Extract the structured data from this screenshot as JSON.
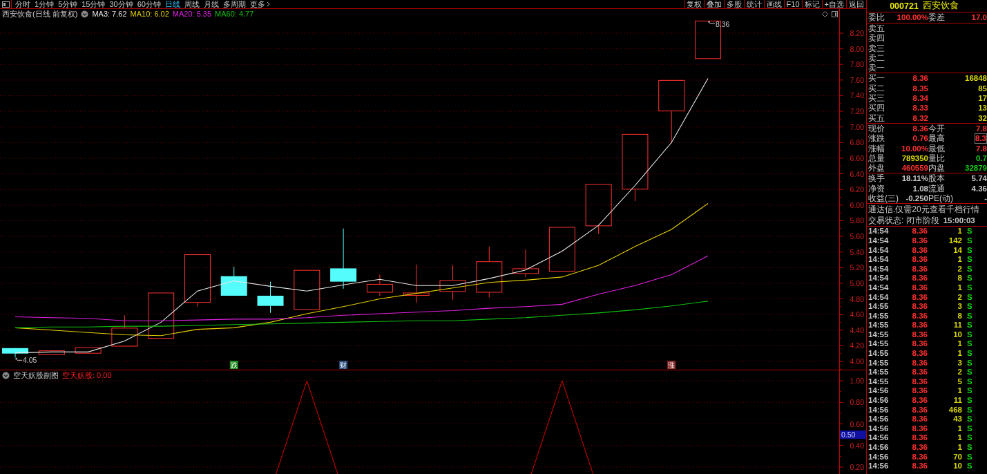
{
  "toolbar": {
    "periods": [
      {
        "label": "分时",
        "kind": "tab",
        "selected": false
      },
      {
        "label": "1分钟",
        "kind": "tab",
        "selected": false
      },
      {
        "label": "5分钟",
        "kind": "tab",
        "selected": false
      },
      {
        "label": "15分钟",
        "kind": "tab",
        "selected": false
      },
      {
        "label": "30分钟",
        "kind": "tab",
        "selected": false
      },
      {
        "label": "60分钟",
        "kind": "tab",
        "selected": false
      },
      {
        "label": "日线",
        "kind": "tab",
        "selected": true
      },
      {
        "label": "周线",
        "kind": "tab",
        "selected": false
      },
      {
        "label": "月线",
        "kind": "tab",
        "selected": false
      },
      {
        "label": "多周期",
        "kind": "tab",
        "selected": false
      },
      {
        "label": "更多",
        "kind": "menu",
        "selected": false
      }
    ],
    "actions": [
      "复权",
      "叠加",
      "多股",
      "统计",
      "画线",
      "F10",
      "标记",
      "+自选",
      "返回"
    ]
  },
  "main_chart": {
    "title": "西安饮食(日线 前复权)",
    "legend": [
      {
        "text": "MA3: 7.62",
        "color": "#e8e8e8"
      },
      {
        "text": "MA10: 6.02",
        "color": "#e6d000"
      },
      {
        "text": "MA20: 5.35",
        "color": "#e020e0"
      },
      {
        "text": "MA60: 4.77",
        "color": "#10c010"
      }
    ],
    "price_axis": [
      "8.20",
      "8.00",
      "7.80",
      "7.60",
      "7.40",
      "7.20",
      "7.00",
      "6.80",
      "6.60",
      "6.40",
      "6.20",
      "6.00",
      "5.80",
      "5.60",
      "5.40",
      "5.20",
      "5.00",
      "4.80",
      "4.60",
      "4.40",
      "4.20",
      "4.00"
    ],
    "high_label": "8.36",
    "low_label": "4.05",
    "events": [
      {
        "label": "跌",
        "color": "#1f8a1f"
      },
      {
        "label": "财",
        "color": "#2b4f80"
      },
      {
        "label": "涨",
        "color": "#8a2a2a"
      }
    ]
  },
  "sub_chart": {
    "title": "空天妖股副图",
    "legend": [
      {
        "text": "空天妖股: 0.00"
      }
    ],
    "axis": [
      "1.00",
      "0.80",
      "0.60",
      "0.40",
      "0.20"
    ],
    "cursor_value": "0.50"
  },
  "quote": {
    "code": "000721",
    "name": "西安饮食",
    "ratio": {
      "label": "委比",
      "value": "100.00%",
      "label2": "委差",
      "value2": "17.0"
    },
    "asks": [
      "卖五",
      "卖四",
      "卖三",
      "卖二",
      "卖一"
    ],
    "bids": [
      {
        "label": "买一",
        "price": "8.36",
        "volume": "16848"
      },
      {
        "label": "买二",
        "price": "8.35",
        "volume": "85"
      },
      {
        "label": "买三",
        "price": "8.34",
        "volume": "17"
      },
      {
        "label": "买四",
        "price": "8.33",
        "volume": "13"
      },
      {
        "label": "买五",
        "price": "8.32",
        "volume": "32"
      }
    ],
    "stats": [
      {
        "left": {
          "label": "现价",
          "value": "8.36",
          "color": "#ff3030"
        },
        "right": {
          "label": "今开",
          "value": "7.8",
          "color": "#ff3030",
          "highlighted": false
        }
      },
      {
        "left": {
          "label": "涨跌",
          "value": "0.76",
          "color": "#ff3030"
        },
        "right": {
          "label": "最高",
          "value": "8.3",
          "color": "#ff3030",
          "highlighted": true
        }
      },
      {
        "left": {
          "label": "涨幅",
          "value": "10.00%",
          "color": "#ff3030"
        },
        "right": {
          "label": "最低",
          "value": "7.8",
          "color": "#ff3030",
          "highlighted": false
        }
      },
      {
        "left": {
          "label": "总量",
          "value": "789350",
          "color": "#d8d800"
        },
        "right": {
          "label": "量比",
          "value": "0.7",
          "color": "#10d010",
          "highlighted": false
        }
      },
      {
        "left": {
          "label": "外盘",
          "value": "460559",
          "color": "#ff3030"
        },
        "right": {
          "label": "内盘",
          "value": "32879",
          "color": "#10d010",
          "highlighted": false
        }
      }
    ],
    "fundamentals": [
      {
        "label": "换手",
        "value": "18.11%",
        "label2": "股本",
        "value2": "5.74"
      },
      {
        "label": "净资",
        "value": "1.08",
        "label2": "流通",
        "value2": "4.36"
      },
      {
        "label": "收益(三)",
        "value": "-0.250",
        "label2": "PE(动)",
        "value2": "-"
      }
    ],
    "notice": "通达信.仅需20元查看千档行情",
    "status": {
      "text": "交易状态: 闭市阶段",
      "time": "15:00:03"
    },
    "ticks": [
      {
        "time": "14:54",
        "price": "8.36",
        "volume": "1",
        "side": "S"
      },
      {
        "time": "14:54",
        "price": "8.36",
        "volume": "142",
        "side": "S"
      },
      {
        "time": "14:54",
        "price": "8.36",
        "volume": "14",
        "side": "S"
      },
      {
        "time": "14:54",
        "price": "8.36",
        "volume": "1",
        "side": "S"
      },
      {
        "time": "14:54",
        "price": "8.36",
        "volume": "2",
        "side": "S"
      },
      {
        "time": "14:54",
        "price": "8.36",
        "volume": "8",
        "side": "S"
      },
      {
        "time": "14:54",
        "price": "8.36",
        "volume": "1",
        "side": "S"
      },
      {
        "time": "14:54",
        "price": "8.36",
        "volume": "2",
        "side": "S"
      },
      {
        "time": "14:55",
        "price": "8.36",
        "volume": "3",
        "side": "S"
      },
      {
        "time": "14:55",
        "price": "8.36",
        "volume": "8",
        "side": "S"
      },
      {
        "time": "14:55",
        "price": "8.36",
        "volume": "11",
        "side": "S"
      },
      {
        "time": "14:55",
        "price": "8.36",
        "volume": "10",
        "side": "S"
      },
      {
        "time": "14:55",
        "price": "8.36",
        "volume": "1",
        "side": "S"
      },
      {
        "time": "14:55",
        "price": "8.36",
        "volume": "1",
        "side": "S"
      },
      {
        "time": "14:55",
        "price": "8.36",
        "volume": "3",
        "side": "S"
      },
      {
        "time": "14:55",
        "price": "8.36",
        "volume": "2",
        "side": "S"
      },
      {
        "time": "14:55",
        "price": "8.36",
        "volume": "5",
        "side": "S"
      },
      {
        "time": "14:56",
        "price": "8.36",
        "volume": "1",
        "side": "S"
      },
      {
        "time": "14:56",
        "price": "8.36",
        "volume": "11",
        "side": "S"
      },
      {
        "time": "14:56",
        "price": "8.36",
        "volume": "468",
        "side": "S"
      },
      {
        "time": "14:56",
        "price": "8.36",
        "volume": "43",
        "side": "S"
      },
      {
        "time": "14:56",
        "price": "8.36",
        "volume": "1",
        "side": "S"
      },
      {
        "time": "14:56",
        "price": "8.36",
        "volume": "1",
        "side": "S"
      },
      {
        "time": "14:56",
        "price": "8.36",
        "volume": "1",
        "side": "S"
      },
      {
        "time": "14:56",
        "price": "8.36",
        "volume": "70",
        "side": "S"
      },
      {
        "time": "14:56",
        "price": "8.36",
        "volume": "10",
        "side": "S"
      }
    ]
  }
}
